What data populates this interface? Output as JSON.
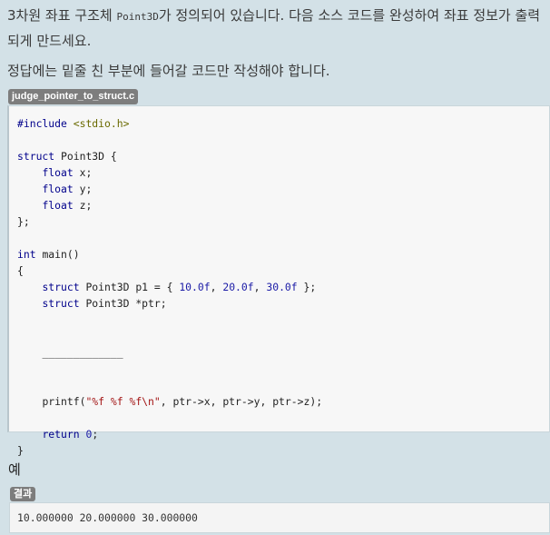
{
  "description": {
    "line1_before": "3차원 좌표 구조체 ",
    "line1_code": "Point3D",
    "line1_after": "가 정의되어 있습니다. 다음 소스 코드를 완성하여 좌표 정보가 출력되게 만드세요.",
    "line2": "정답에는 밑줄 친 부분에 들어갈 코드만 작성해야 합니다."
  },
  "file": {
    "name": "judge_pointer_to_struct.c"
  },
  "code": {
    "include_kw": "#include",
    "include_hdr": "<stdio.h>",
    "struct_kw": "struct",
    "struct_name": "Point3D {",
    "float_kw": "float",
    "field_x": "x;",
    "field_y": "y;",
    "field_z": "z;",
    "struct_end": "};",
    "int_kw": "int",
    "main_sig": "main()",
    "open_brace": "{",
    "p1_decl": "Point3D p1 = { ",
    "v1": "10.0f",
    "v2": "20.0f",
    "v3": "30.0f",
    "p1_end": " };",
    "ptr_decl": "Point3D *ptr;",
    "blank_line": "_____________",
    "printf_fn": "printf(",
    "printf_fmt": "\"%f %f %f\\n\"",
    "printf_args": ", ptr->x, ptr->y, ptr->z);",
    "return_kw": "return",
    "return_val": "0",
    "semicolon": ";",
    "close_brace": "}"
  },
  "example": {
    "title": "예",
    "result_label": "결과",
    "output": "10.000000 20.000000 30.000000"
  }
}
